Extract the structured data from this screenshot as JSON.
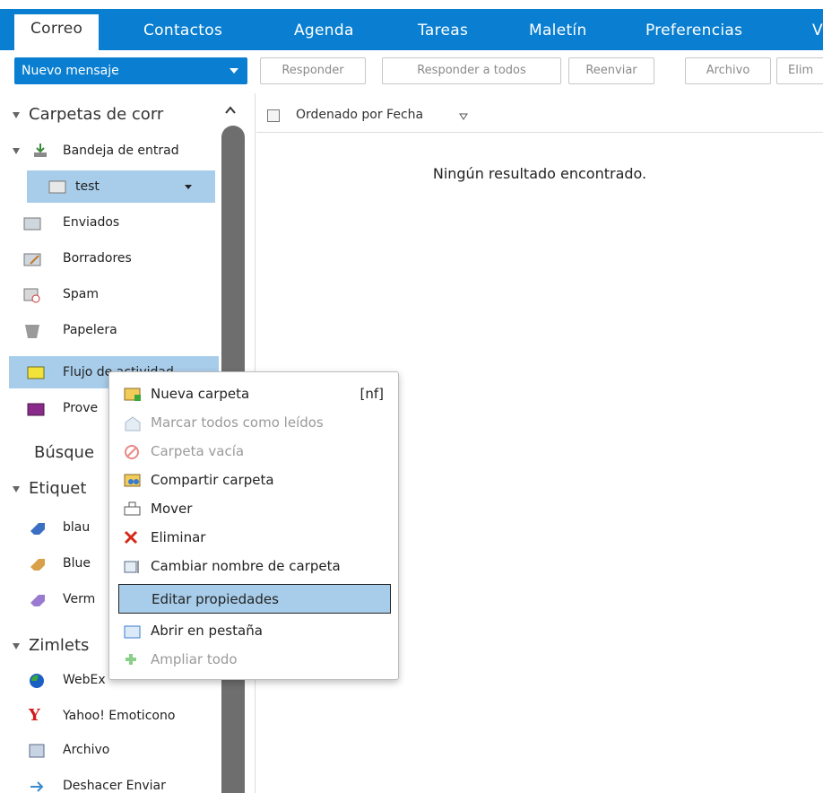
{
  "tabs": [
    {
      "label": "Correo",
      "active": true
    },
    {
      "label": "Contactos"
    },
    {
      "label": "Agenda"
    },
    {
      "label": "Tareas"
    },
    {
      "label": "Maletín"
    },
    {
      "label": "Preferencias"
    }
  ],
  "toolbar": {
    "new_message": "Nuevo mensaje",
    "buttons": [
      "Responder",
      "Responder a todos",
      "Reenviar",
      "Archivo",
      "Elim"
    ]
  },
  "sidebar": {
    "mail_folders_header": "Carpetas de corr",
    "inbox": "Bandeja de entrad",
    "test": "test",
    "sent": "Enviados",
    "drafts": "Borradores",
    "spam": "Spam",
    "trash": "Papelera",
    "activity": "Flujo de actividad",
    "providers": "Prove",
    "searches": "Búsque",
    "tags_header": "Etiquet",
    "tags": [
      "blau",
      "Blue",
      "Verm"
    ],
    "zimlets_header": "Zimlets",
    "zimlets": [
      "WebEx",
      "Yahoo! Emoticono",
      "Archivo",
      "Deshacer Enviar"
    ]
  },
  "list": {
    "sort_label": "Ordenado por Fecha",
    "empty_text": "Ningún resultado encontrado."
  },
  "context_menu": {
    "items": [
      {
        "label": "Nueva carpeta",
        "shortcut": "[nf]",
        "enabled": true
      },
      {
        "label": "Marcar todos como leídos",
        "enabled": false
      },
      {
        "label": "Carpeta vacía",
        "enabled": false
      },
      {
        "label": "Compartir carpeta",
        "enabled": true
      },
      {
        "label": "Mover",
        "enabled": true
      },
      {
        "label": "Eliminar",
        "enabled": true
      },
      {
        "label": "Cambiar nombre de carpeta",
        "enabled": true
      },
      {
        "label": "Editar propiedades",
        "enabled": true,
        "highlighted": true
      },
      {
        "label": "Abrir en pestaña",
        "enabled": true
      },
      {
        "label": "Ampliar todo",
        "enabled": false
      }
    ]
  },
  "colors": {
    "accent": "#0a7fd1",
    "selection": "#a8cdea"
  }
}
